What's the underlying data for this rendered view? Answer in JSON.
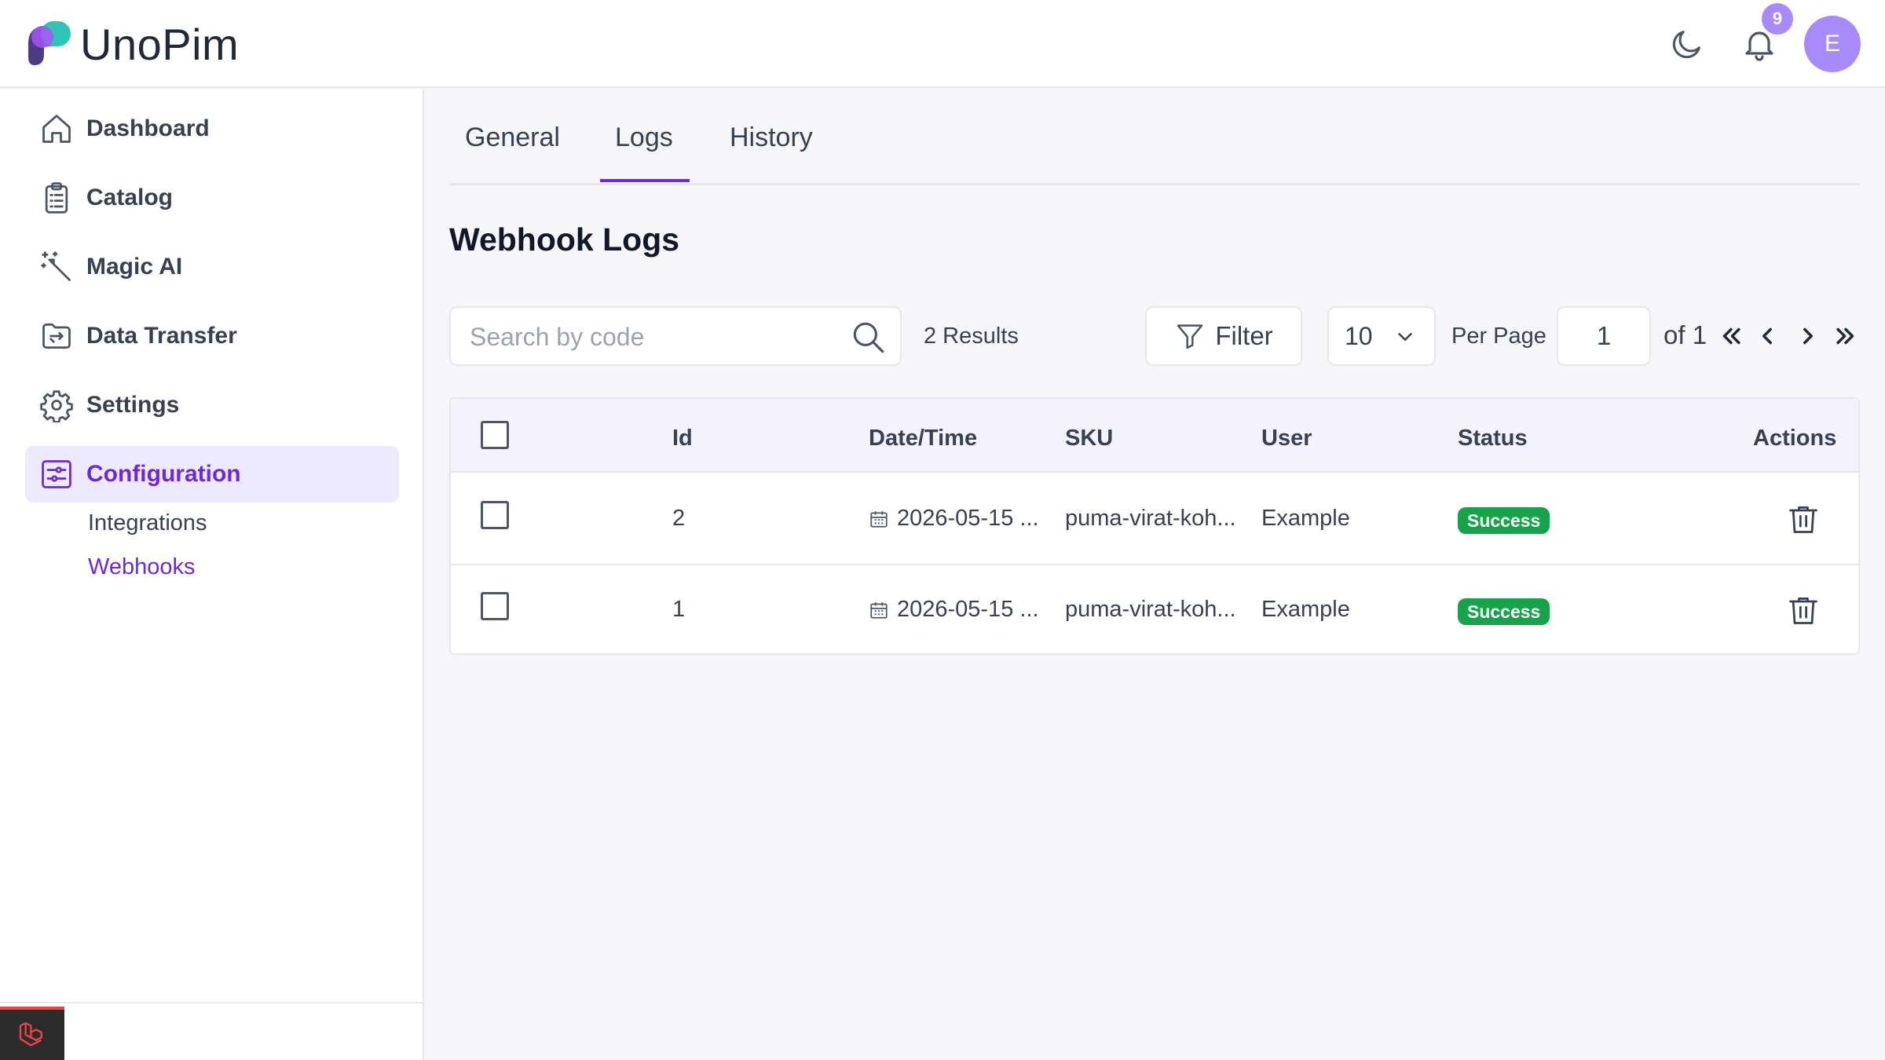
{
  "header": {
    "brand": "UnoPim",
    "notification_count": "9",
    "avatar_initial": "E",
    "icons": [
      "moon-icon",
      "bell-icon"
    ]
  },
  "sidebar": {
    "items": [
      {
        "label": "Dashboard",
        "icon": "home-icon"
      },
      {
        "label": "Catalog",
        "icon": "clipboard-icon"
      },
      {
        "label": "Magic AI",
        "icon": "magic-wand-icon"
      },
      {
        "label": "Data Transfer",
        "icon": "transfer-icon"
      },
      {
        "label": "Settings",
        "icon": "gear-icon"
      },
      {
        "label": "Configuration",
        "icon": "sliders-icon",
        "active": true
      }
    ],
    "subitems": [
      {
        "label": "Integrations"
      },
      {
        "label": "Webhooks",
        "active": true
      }
    ]
  },
  "tabs": [
    {
      "label": "General"
    },
    {
      "label": "Logs",
      "active": true
    },
    {
      "label": "History"
    }
  ],
  "page": {
    "title": "Webhook Logs"
  },
  "toolbar": {
    "search_placeholder": "Search by code",
    "results": "2 Results",
    "filter_label": "Filter",
    "per_page_value": "10",
    "per_page_label": "Per Page",
    "current_page": "1",
    "of_label": "of 1"
  },
  "table": {
    "columns": [
      "Id",
      "Date/Time",
      "SKU",
      "User",
      "Status",
      "Actions"
    ],
    "rows": [
      {
        "id": "2",
        "datetime": "2026-05-15 ...",
        "sku": "puma-virat-koh...",
        "user": "Example",
        "status": "Success"
      },
      {
        "id": "1",
        "datetime": "2026-05-15 ...",
        "sku": "puma-virat-koh...",
        "user": "Example",
        "status": "Success"
      }
    ]
  },
  "colors": {
    "accent": "#6d28d9",
    "accent_light": "#ede9fe",
    "avatar": "#a78bfa",
    "success": "#16a34a"
  }
}
